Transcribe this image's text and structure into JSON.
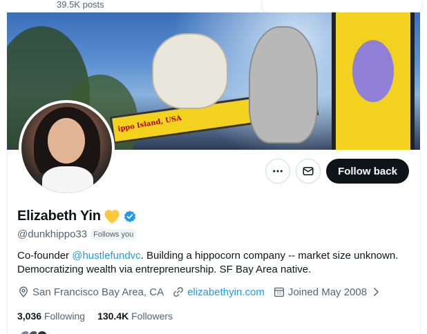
{
  "header": {
    "post_count": "39.5K posts"
  },
  "banner": {
    "sign_text": "ippo Island, USA"
  },
  "actions": {
    "more_label": "More",
    "message_label": "Message",
    "follow_back_label": "Follow back"
  },
  "profile": {
    "display_name": "Elizabeth Yin",
    "handle": "@dunkhippo33",
    "follows_you": "Follows you",
    "bio_prefix": "Co-founder ",
    "bio_link": "@hustlefundvc",
    "bio_suffix": ". Building a hippocorn company -- market size unknown. Democratizing wealth via entrepreneurship. SF Bay Area native.",
    "location": "San Francisco Bay Area, CA",
    "website": "elizabethyin.com",
    "joined": "Joined May 2008"
  },
  "stats": {
    "following_count": "3,036",
    "following_label": "Following",
    "followers_count": "130.4K",
    "followers_label": "Followers"
  },
  "icons": {
    "heart": "yellow-heart-icon",
    "verified": "verified-badge-icon",
    "location": "location-pin-icon",
    "link": "link-icon",
    "calendar": "calendar-icon",
    "more": "more-dots-icon",
    "message": "envelope-icon",
    "chevron": "chevron-right-icon"
  },
  "colors": {
    "accent_link": "#1d9bf0",
    "text_primary": "#0f1419",
    "text_secondary": "#536471",
    "follow_button_bg": "#0f1419",
    "heart": "#ffc83d",
    "verified": "#1d9bf0"
  }
}
